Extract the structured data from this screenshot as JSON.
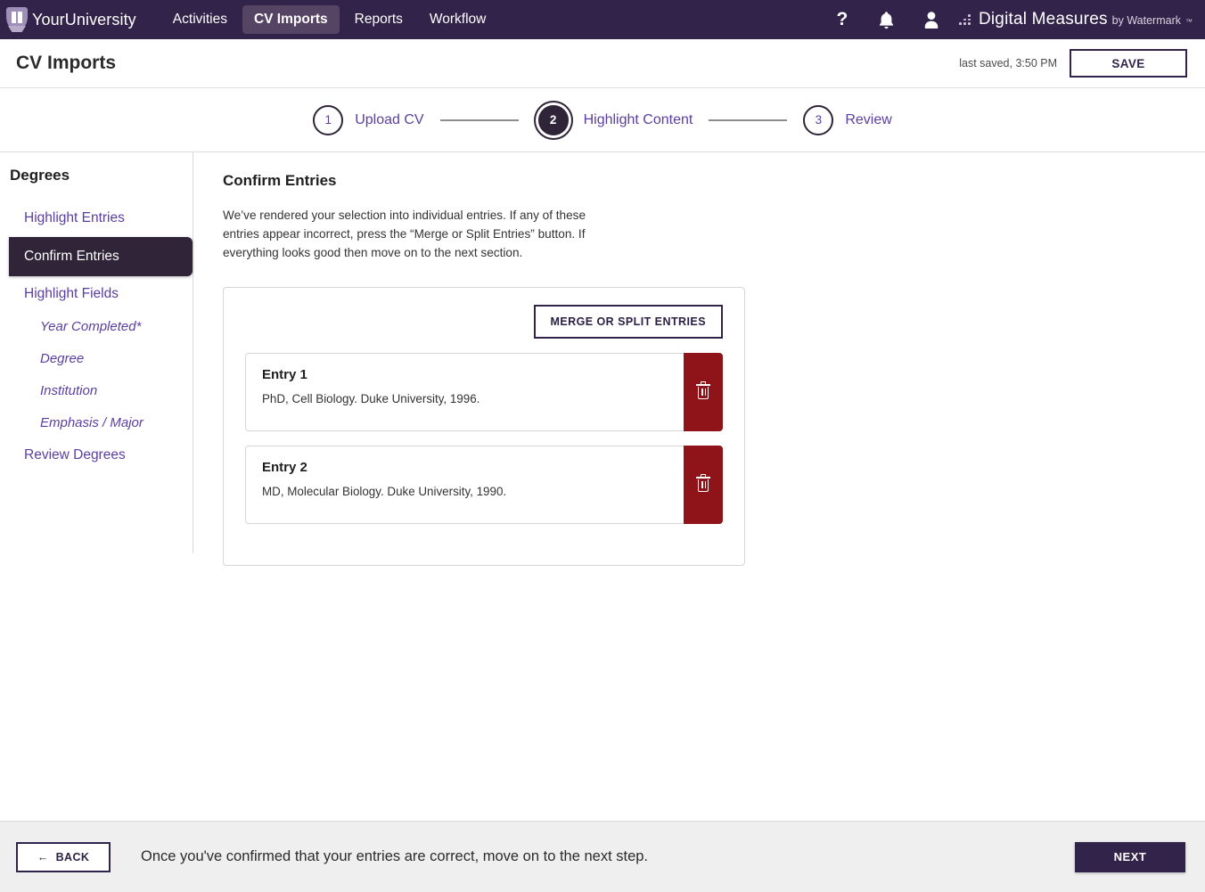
{
  "topnav": {
    "brand": "YourUniversity",
    "brand_icon": "university-crest-icon",
    "items": [
      {
        "label": "Activities",
        "active": false
      },
      {
        "label": "CV Imports",
        "active": true
      },
      {
        "label": "Reports",
        "active": false
      },
      {
        "label": "Workflow",
        "active": false
      }
    ],
    "icons": [
      {
        "name": "help-icon",
        "glyph": "?"
      },
      {
        "name": "notifications-bell-icon",
        "glyph": "\u0000"
      },
      {
        "name": "user-account-icon",
        "glyph": "\u0000"
      }
    ],
    "product_name": "Digital Measures",
    "product_sub": "by Watermark",
    "product_tm": "™",
    "background_color": "#32234a",
    "active_tab_color": "#564465"
  },
  "titlebar": {
    "title": "CV Imports",
    "last_saved": "last saved, 3:50 PM",
    "save_label": "SAVE"
  },
  "stepper": {
    "steps": [
      {
        "number": "1",
        "label": "Upload CV",
        "state": "incomplete"
      },
      {
        "number": "2",
        "label": "Highlight Content",
        "state": "current"
      },
      {
        "number": "3",
        "label": "Review",
        "state": "incomplete"
      }
    ],
    "link_color": "#5b3fa0",
    "current_color": "#2f2438"
  },
  "sidebar": {
    "title": "Degrees",
    "items": [
      {
        "label": "Highlight Entries",
        "level": "top",
        "active": false
      },
      {
        "label": "Confirm Entries",
        "level": "top",
        "active": true
      },
      {
        "label": "Highlight Fields",
        "level": "top",
        "active": false
      },
      {
        "label": "Year Completed*",
        "level": "sub",
        "active": false
      },
      {
        "label": "Degree",
        "level": "sub",
        "active": false
      },
      {
        "label": "Institution",
        "level": "sub",
        "active": false
      },
      {
        "label": "Emphasis / Major",
        "level": "sub",
        "active": false
      },
      {
        "label": "Review Degrees",
        "level": "top",
        "active": false
      }
    ]
  },
  "main": {
    "section_title": "Confirm Entries",
    "section_desc": "We’ve rendered your selection into individual entries. If any of these entries appear incorrect, press the “Merge or Split Entries” button. If everything looks good then move on to the next section.",
    "merge_button": "MERGE OR SPLIT ENTRIES",
    "delete_icon": "trash-icon",
    "delete_color": "#8f1419",
    "entries": [
      {
        "title": "Entry 1",
        "text": "PhD, Cell Biology. Duke University, 1996."
      },
      {
        "title": "Entry 2",
        "text": "MD, Molecular Biology. Duke University, 1990."
      }
    ]
  },
  "footer": {
    "back_label": "BACK",
    "back_icon": "arrow-left-icon",
    "message": "Once you've confirmed that your entries are correct, move on to the next step.",
    "next_label": "NEXT"
  }
}
